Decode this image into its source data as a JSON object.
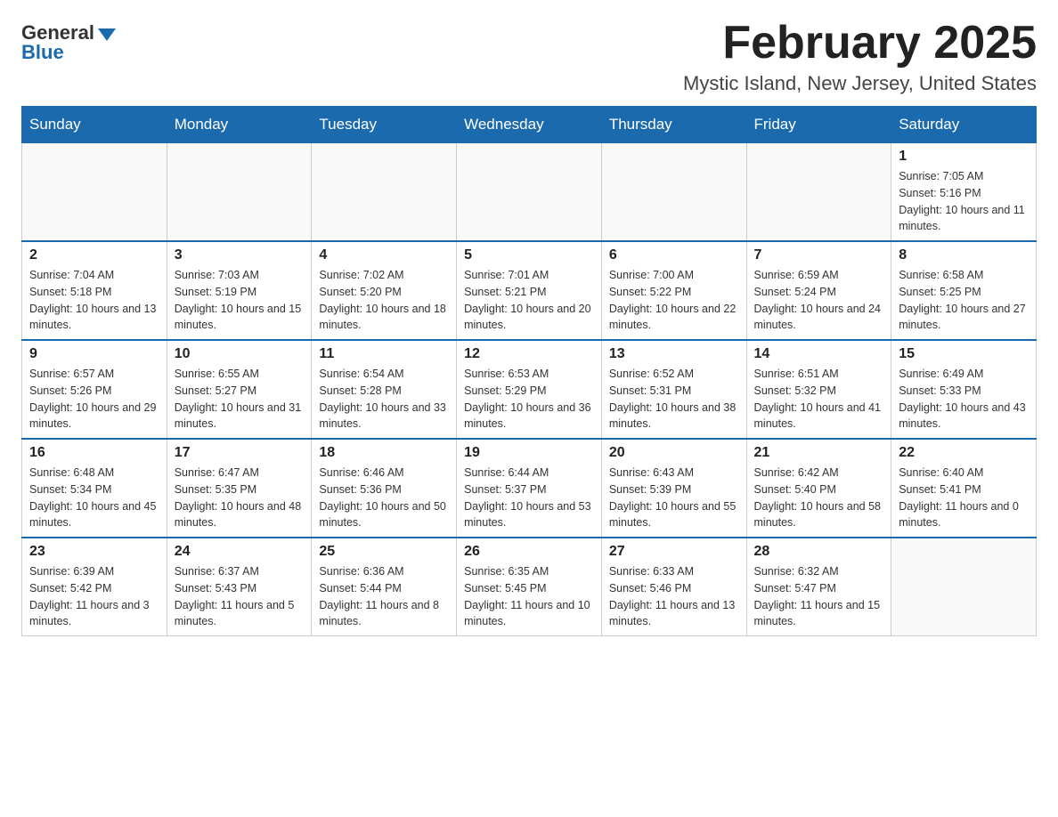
{
  "logo": {
    "general": "General",
    "blue": "Blue"
  },
  "header": {
    "month_year": "February 2025",
    "location": "Mystic Island, New Jersey, United States"
  },
  "days_of_week": [
    "Sunday",
    "Monday",
    "Tuesday",
    "Wednesday",
    "Thursday",
    "Friday",
    "Saturday"
  ],
  "weeks": [
    [
      {
        "day": "",
        "sunrise": "",
        "sunset": "",
        "daylight": ""
      },
      {
        "day": "",
        "sunrise": "",
        "sunset": "",
        "daylight": ""
      },
      {
        "day": "",
        "sunrise": "",
        "sunset": "",
        "daylight": ""
      },
      {
        "day": "",
        "sunrise": "",
        "sunset": "",
        "daylight": ""
      },
      {
        "day": "",
        "sunrise": "",
        "sunset": "",
        "daylight": ""
      },
      {
        "day": "",
        "sunrise": "",
        "sunset": "",
        "daylight": ""
      },
      {
        "day": "1",
        "sunrise": "Sunrise: 7:05 AM",
        "sunset": "Sunset: 5:16 PM",
        "daylight": "Daylight: 10 hours and 11 minutes."
      }
    ],
    [
      {
        "day": "2",
        "sunrise": "Sunrise: 7:04 AM",
        "sunset": "Sunset: 5:18 PM",
        "daylight": "Daylight: 10 hours and 13 minutes."
      },
      {
        "day": "3",
        "sunrise": "Sunrise: 7:03 AM",
        "sunset": "Sunset: 5:19 PM",
        "daylight": "Daylight: 10 hours and 15 minutes."
      },
      {
        "day": "4",
        "sunrise": "Sunrise: 7:02 AM",
        "sunset": "Sunset: 5:20 PM",
        "daylight": "Daylight: 10 hours and 18 minutes."
      },
      {
        "day": "5",
        "sunrise": "Sunrise: 7:01 AM",
        "sunset": "Sunset: 5:21 PM",
        "daylight": "Daylight: 10 hours and 20 minutes."
      },
      {
        "day": "6",
        "sunrise": "Sunrise: 7:00 AM",
        "sunset": "Sunset: 5:22 PM",
        "daylight": "Daylight: 10 hours and 22 minutes."
      },
      {
        "day": "7",
        "sunrise": "Sunrise: 6:59 AM",
        "sunset": "Sunset: 5:24 PM",
        "daylight": "Daylight: 10 hours and 24 minutes."
      },
      {
        "day": "8",
        "sunrise": "Sunrise: 6:58 AM",
        "sunset": "Sunset: 5:25 PM",
        "daylight": "Daylight: 10 hours and 27 minutes."
      }
    ],
    [
      {
        "day": "9",
        "sunrise": "Sunrise: 6:57 AM",
        "sunset": "Sunset: 5:26 PM",
        "daylight": "Daylight: 10 hours and 29 minutes."
      },
      {
        "day": "10",
        "sunrise": "Sunrise: 6:55 AM",
        "sunset": "Sunset: 5:27 PM",
        "daylight": "Daylight: 10 hours and 31 minutes."
      },
      {
        "day": "11",
        "sunrise": "Sunrise: 6:54 AM",
        "sunset": "Sunset: 5:28 PM",
        "daylight": "Daylight: 10 hours and 33 minutes."
      },
      {
        "day": "12",
        "sunrise": "Sunrise: 6:53 AM",
        "sunset": "Sunset: 5:29 PM",
        "daylight": "Daylight: 10 hours and 36 minutes."
      },
      {
        "day": "13",
        "sunrise": "Sunrise: 6:52 AM",
        "sunset": "Sunset: 5:31 PM",
        "daylight": "Daylight: 10 hours and 38 minutes."
      },
      {
        "day": "14",
        "sunrise": "Sunrise: 6:51 AM",
        "sunset": "Sunset: 5:32 PM",
        "daylight": "Daylight: 10 hours and 41 minutes."
      },
      {
        "day": "15",
        "sunrise": "Sunrise: 6:49 AM",
        "sunset": "Sunset: 5:33 PM",
        "daylight": "Daylight: 10 hours and 43 minutes."
      }
    ],
    [
      {
        "day": "16",
        "sunrise": "Sunrise: 6:48 AM",
        "sunset": "Sunset: 5:34 PM",
        "daylight": "Daylight: 10 hours and 45 minutes."
      },
      {
        "day": "17",
        "sunrise": "Sunrise: 6:47 AM",
        "sunset": "Sunset: 5:35 PM",
        "daylight": "Daylight: 10 hours and 48 minutes."
      },
      {
        "day": "18",
        "sunrise": "Sunrise: 6:46 AM",
        "sunset": "Sunset: 5:36 PM",
        "daylight": "Daylight: 10 hours and 50 minutes."
      },
      {
        "day": "19",
        "sunrise": "Sunrise: 6:44 AM",
        "sunset": "Sunset: 5:37 PM",
        "daylight": "Daylight: 10 hours and 53 minutes."
      },
      {
        "day": "20",
        "sunrise": "Sunrise: 6:43 AM",
        "sunset": "Sunset: 5:39 PM",
        "daylight": "Daylight: 10 hours and 55 minutes."
      },
      {
        "day": "21",
        "sunrise": "Sunrise: 6:42 AM",
        "sunset": "Sunset: 5:40 PM",
        "daylight": "Daylight: 10 hours and 58 minutes."
      },
      {
        "day": "22",
        "sunrise": "Sunrise: 6:40 AM",
        "sunset": "Sunset: 5:41 PM",
        "daylight": "Daylight: 11 hours and 0 minutes."
      }
    ],
    [
      {
        "day": "23",
        "sunrise": "Sunrise: 6:39 AM",
        "sunset": "Sunset: 5:42 PM",
        "daylight": "Daylight: 11 hours and 3 minutes."
      },
      {
        "day": "24",
        "sunrise": "Sunrise: 6:37 AM",
        "sunset": "Sunset: 5:43 PM",
        "daylight": "Daylight: 11 hours and 5 minutes."
      },
      {
        "day": "25",
        "sunrise": "Sunrise: 6:36 AM",
        "sunset": "Sunset: 5:44 PM",
        "daylight": "Daylight: 11 hours and 8 minutes."
      },
      {
        "day": "26",
        "sunrise": "Sunrise: 6:35 AM",
        "sunset": "Sunset: 5:45 PM",
        "daylight": "Daylight: 11 hours and 10 minutes."
      },
      {
        "day": "27",
        "sunrise": "Sunrise: 6:33 AM",
        "sunset": "Sunset: 5:46 PM",
        "daylight": "Daylight: 11 hours and 13 minutes."
      },
      {
        "day": "28",
        "sunrise": "Sunrise: 6:32 AM",
        "sunset": "Sunset: 5:47 PM",
        "daylight": "Daylight: 11 hours and 15 minutes."
      },
      {
        "day": "",
        "sunrise": "",
        "sunset": "",
        "daylight": ""
      }
    ]
  ]
}
